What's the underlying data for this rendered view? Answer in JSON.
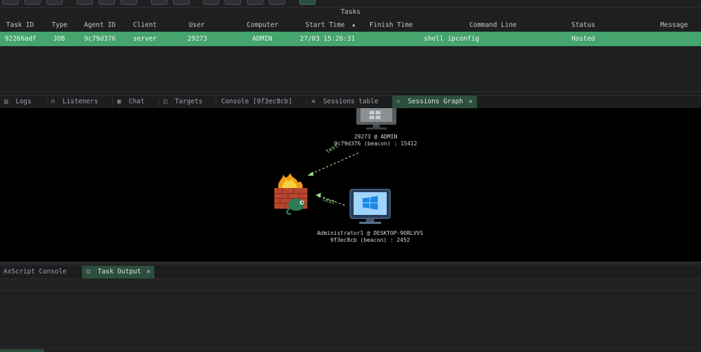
{
  "tasks": {
    "title": "Tasks",
    "columns": [
      "Task ID",
      "Type",
      "Agent ID",
      "Client",
      "User",
      "Computer",
      "Start Time",
      "▲",
      "Finish Time",
      "Command Line",
      "Status",
      "Message"
    ],
    "rows": [
      {
        "task_id": "92266adf",
        "type": "JOB",
        "agent_id": "9c79d376",
        "client": "server",
        "user": "29273",
        "computer": "ADMIN",
        "start_time": "27/03 15:26:31",
        "finish_time": "",
        "command_line": "shell ipconfig",
        "status": "Hosted",
        "message": ""
      }
    ]
  },
  "tabs": [
    {
      "label": "Logs",
      "icon": "▤"
    },
    {
      "label": "Listeners",
      "icon": "∩"
    },
    {
      "label": "Chat",
      "icon": "▣"
    },
    {
      "label": "Targets",
      "icon": "◫"
    },
    {
      "label": "Console [9f3ec8cb]",
      "icon": ""
    },
    {
      "label": "Sessions table",
      "icon": "≡"
    },
    {
      "label": "Sessions Graph",
      "icon": "✲",
      "close": "✕"
    }
  ],
  "graph": {
    "nodes": [
      {
        "id": "top-session",
        "line1": "29273 @ ADMIN",
        "line2": "9c79d376 (beacon) : 15412"
      },
      {
        "id": "bottom-session",
        "line1": "Administrator1 @ DESKTOP-9ORLVVS",
        "line2": "9f3ec8cb (beacon) : 2452"
      }
    ],
    "edges": [
      {
        "label": "test"
      },
      {
        "label": "test"
      }
    ]
  },
  "bottom_tabs": [
    {
      "label": "AxScript Console"
    },
    {
      "label": "Task Output",
      "icon": "⧉",
      "close": "✕"
    }
  ],
  "colors": {
    "accent": "#45a56c",
    "tab_active": "#2b4f3c",
    "edge": "#9fe28a"
  }
}
